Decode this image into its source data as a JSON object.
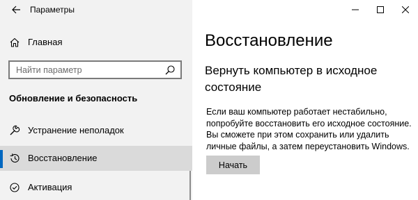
{
  "app": {
    "title": "Параметры"
  },
  "sidebar": {
    "home_label": "Главная",
    "search": {
      "placeholder": "Найти параметр"
    },
    "section_title": "Обновление и безопасность",
    "items": [
      {
        "label": "Устранение неполадок",
        "icon": "wrench-icon",
        "selected": false
      },
      {
        "label": "Восстановление",
        "icon": "history-icon",
        "selected": true
      },
      {
        "label": "Активация",
        "icon": "check-circle-icon",
        "selected": false
      }
    ]
  },
  "main": {
    "title": "Восстановление",
    "reset": {
      "heading": "Вернуть компьютер в исходное состояние",
      "description": "Если ваш компьютер работает нестабильно, попробуйте восстановить его исходное состояние. Вы сможете при этом сохранить или удалить личные файлы, а затем переустановить Windows.",
      "button_label": "Начать"
    }
  },
  "colors": {
    "sidebar_bg": "#f2f2f2",
    "selected_bg": "#dadada",
    "accent": "#0067c0",
    "button_bg": "#cccccc"
  }
}
